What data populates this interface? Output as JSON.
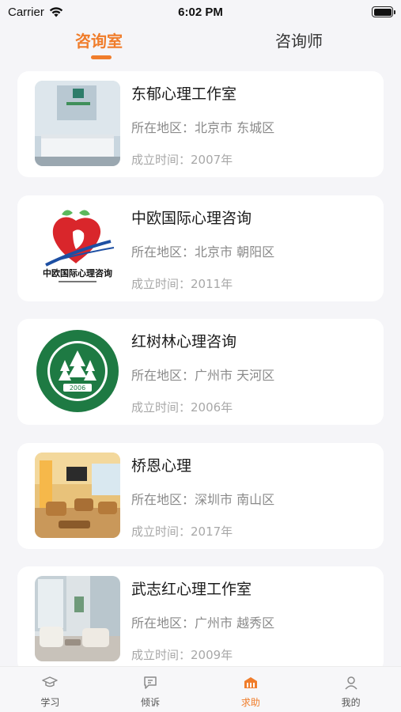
{
  "status_bar": {
    "carrier": "Carrier",
    "time": "6:02 PM"
  },
  "top_tabs": [
    {
      "label": "咨询室",
      "active": true
    },
    {
      "label": "咨询师",
      "active": false
    }
  ],
  "accent_color": "#f07d2b",
  "cards": [
    {
      "name": "东郁心理工作室",
      "region": "所在地区：北京市 东城区",
      "founded": "成立时间：2007年",
      "thumb_icon": "office-reception-photo"
    },
    {
      "name": "中欧国际心理咨询",
      "region": "所在地区：北京市 朝阳区",
      "founded": "成立时间：2011年",
      "thumb_icon": "heart-apple-logo",
      "logo_text": "中欧国际心理咨询"
    },
    {
      "name": "红树林心理咨询",
      "region": "所在地区：广州市 天河区",
      "founded": "成立时间：2006年",
      "thumb_icon": "green-seal-logo",
      "logo_text": "2006"
    },
    {
      "name": "桥恩心理",
      "region": "所在地区：深圳市 南山区",
      "founded": "成立时间：2017年",
      "thumb_icon": "lounge-photo"
    },
    {
      "name": "武志红心理工作室",
      "region": "所在地区：广州市 越秀区",
      "founded": "成立时间：2009年",
      "thumb_icon": "room-photo"
    }
  ],
  "bottom_nav": [
    {
      "label": "学习",
      "icon": "graduation-cap-icon",
      "active": false
    },
    {
      "label": "倾诉",
      "icon": "chat-bubble-icon",
      "active": false
    },
    {
      "label": "求助",
      "icon": "building-icon",
      "active": true
    },
    {
      "label": "我的",
      "icon": "person-icon",
      "active": false
    }
  ]
}
